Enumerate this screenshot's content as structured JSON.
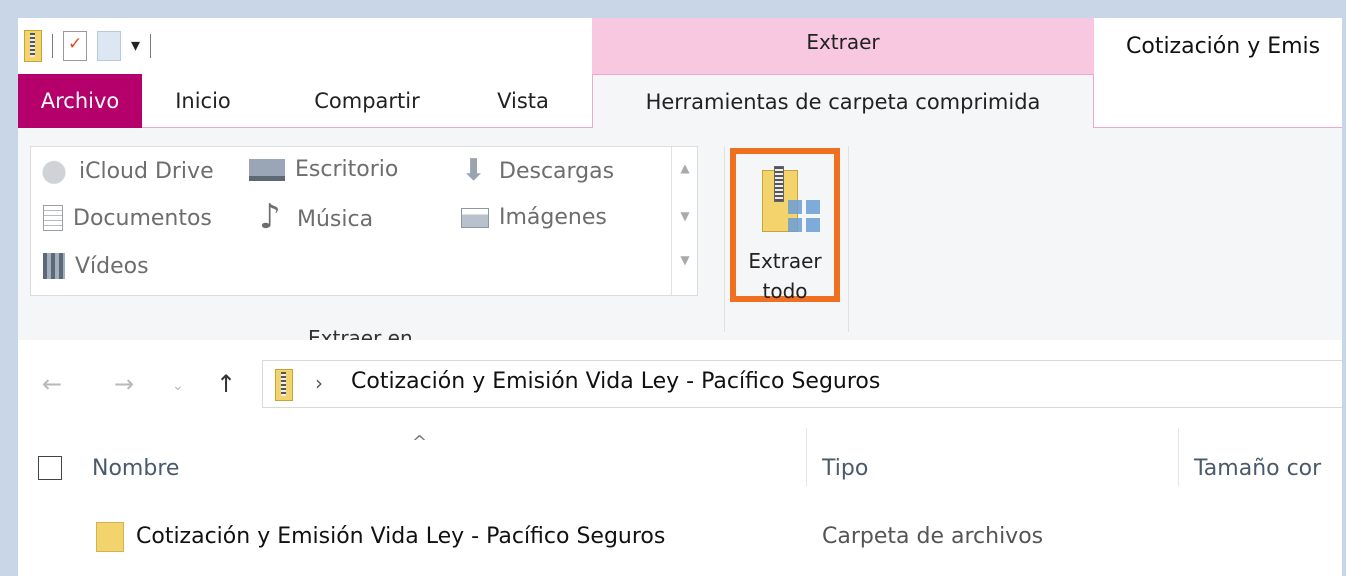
{
  "window": {
    "title": "Cotización y Emis",
    "contextual_tab_group": "Extraer",
    "accent_color": "#b5006c",
    "contextual_color": "#f7c8e0"
  },
  "quick_access": {
    "icons": [
      "zip-folder-icon",
      "properties-icon",
      "new-folder-icon"
    ],
    "customize_glyph": "▾"
  },
  "tabs": [
    {
      "label": "Archivo"
    },
    {
      "label": "Inicio"
    },
    {
      "label": "Compartir"
    },
    {
      "label": "Vista"
    },
    {
      "label": "Herramientas de carpeta comprimida",
      "active": true
    }
  ],
  "ribbon": {
    "extract_to": {
      "group_label": "Extraer en",
      "items": [
        {
          "label": "iCloud Drive",
          "icon": "cloud-icon"
        },
        {
          "label": "Escritorio",
          "icon": "desktop-icon"
        },
        {
          "label": "Descargas",
          "icon": "download-icon"
        },
        {
          "label": "Documentos",
          "icon": "documents-icon"
        },
        {
          "label": "Música",
          "icon": "music-icon"
        },
        {
          "label": "Imágenes",
          "icon": "pictures-icon"
        },
        {
          "label": "Vídeos",
          "icon": "videos-icon"
        }
      ]
    },
    "extract_all": {
      "line1": "Extraer",
      "line2": "todo",
      "highlight_color": "#f07021"
    }
  },
  "address_bar": {
    "path": "Cotización y Emisión Vida Ley - Pacífico Seguros",
    "separator": "›"
  },
  "file_list": {
    "columns": [
      "Nombre",
      "Tipo",
      "Tamaño cor"
    ],
    "rows": [
      {
        "name": "Cotización y Emisión Vida Ley - Pacífico Seguros",
        "type": "Carpeta de archivos"
      }
    ]
  }
}
